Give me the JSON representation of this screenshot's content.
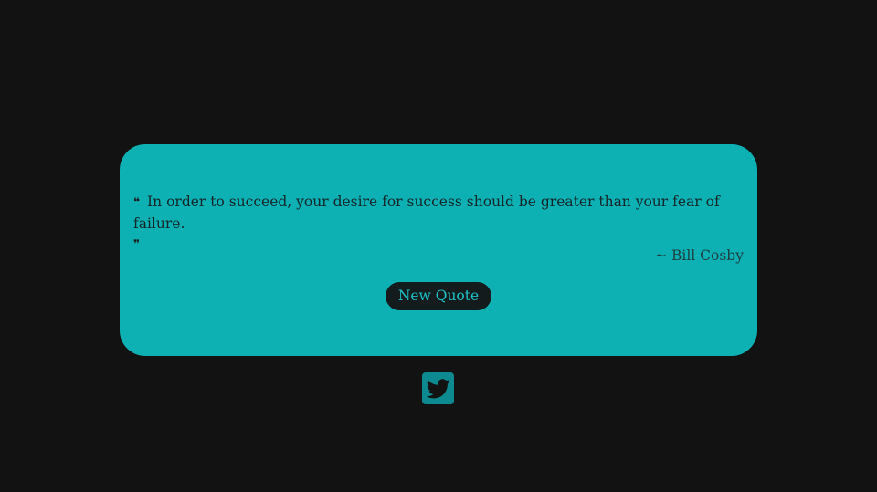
{
  "quote": {
    "open_mark": "❝",
    "text": "In order to succeed, your desire for success should be greater than your fear of failure.",
    "close_mark": "❞",
    "author": "~ Bill Cosby"
  },
  "actions": {
    "new_quote_label": "New Quote",
    "tweet_icon": "twitter-icon"
  },
  "colors": {
    "background": "#121212",
    "card": "#0db0b3",
    "button_bg": "#131b1c",
    "button_text": "#1fc2c4",
    "tweet_button": "#0d8a8f"
  }
}
